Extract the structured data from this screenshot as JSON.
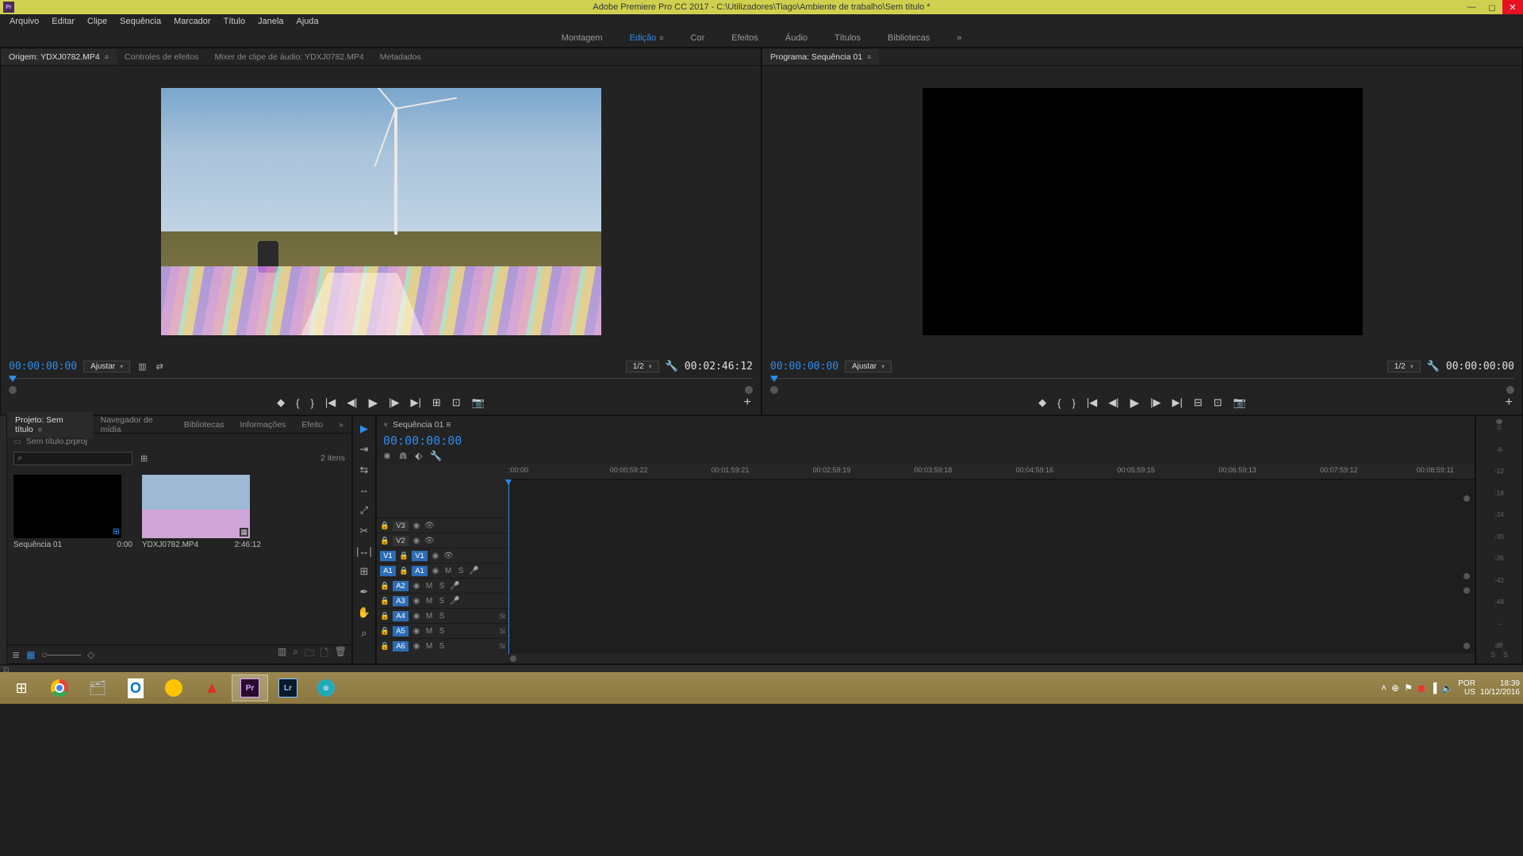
{
  "titlebar": {
    "app": "Pr",
    "title": "Adobe Premiere Pro CC 2017 - C:\\Utilizadores\\Tiago\\Ambiente de trabalho\\Sem título *"
  },
  "menu": [
    "Arquivo",
    "Editar",
    "Clipe",
    "Sequência",
    "Marcador",
    "Título",
    "Janela",
    "Ajuda"
  ],
  "workspaces": {
    "items": [
      "Montagem",
      "Edição",
      "Cor",
      "Efeitos",
      "Áudio",
      "Títulos",
      "Bibliotecas"
    ],
    "active": 1,
    "moreIcon": "»"
  },
  "source": {
    "tabs": [
      "Origem: YDXJ0782.MP4",
      "Controles de efeitos",
      "Mixer de clipe de áudio: YDXJ0782.MP4",
      "Metadados"
    ],
    "activeTab": 0,
    "currentTc": "00:00:00:00",
    "fit": "Ajustar",
    "zoom": "1/2",
    "durationTc": "00:02:46:12"
  },
  "program": {
    "tab": "Programa: Sequência 01",
    "currentTc": "00:00:00:00",
    "fit": "Ajustar",
    "zoom": "1/2",
    "durationTc": "00:00:00:00"
  },
  "project": {
    "tabs": [
      "Projeto: Sem título",
      "Navegador de mídia",
      "Bibliotecas",
      "Informações",
      "Efeito"
    ],
    "activeTab": 0,
    "subtitle": "Sem título.prproj",
    "itemsCount": "2 itens",
    "items": [
      {
        "name": "Sequência 01",
        "duration": "0:00",
        "type": "sequence"
      },
      {
        "name": "YDXJ0782.MP4",
        "duration": "2:46:12",
        "type": "video"
      }
    ]
  },
  "timeline": {
    "tab": "Sequência 01",
    "tc": "00:00:00:00",
    "ruler": [
      ":00:00",
      "00:00:59:22",
      "00:01:59:21",
      "00:02:59:19",
      "00:03:59:18",
      "00:04:59:16",
      "00:05:59:15",
      "00:06:59:13",
      "00:07:59:12",
      "00:08:59:11"
    ],
    "videoTracks": [
      {
        "name": "V3",
        "selected": false
      },
      {
        "name": "V2",
        "selected": false
      },
      {
        "name": "V1",
        "selected": true,
        "src": "V1"
      }
    ],
    "audioTracks": [
      {
        "name": "A1",
        "selected": true,
        "src": "A1",
        "st": ""
      },
      {
        "name": "A2",
        "selected": false,
        "st": ""
      },
      {
        "name": "A3",
        "selected": false,
        "st": ""
      },
      {
        "name": "A4",
        "selected": false,
        "st": "St"
      },
      {
        "name": "A5",
        "selected": false,
        "st": "St"
      },
      {
        "name": "A6",
        "selected": false,
        "st": "St"
      }
    ]
  },
  "meter": {
    "scale": [
      "0",
      "-6",
      "-12",
      "-18",
      "-24",
      "-30",
      "-36",
      "-42",
      "-48",
      "--",
      "dB"
    ],
    "labels": [
      "S",
      "S"
    ]
  },
  "taskbar": {
    "apps": [
      "start",
      "chrome",
      "explorer",
      "outlook",
      "autodesk",
      "abbyy",
      "premiere",
      "lightroom",
      "obs"
    ],
    "active": "premiere",
    "lang1": "POR",
    "lang2": "US",
    "time": "18:39",
    "date": "10/12/2016"
  }
}
